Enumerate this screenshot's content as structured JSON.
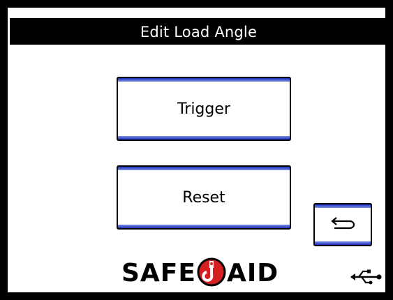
{
  "header": {
    "title": "Edit Load Angle"
  },
  "buttons": {
    "trigger_label": "Trigger",
    "reset_label": "Reset",
    "back_icon": "return-arrow-icon"
  },
  "footer": {
    "logo_left": "SAFE",
    "logo_right": "AID",
    "logo_mark": "hook-logo-icon",
    "usb_icon": "usb-icon"
  },
  "colors": {
    "title_bar": "#000000",
    "button_accent": "#1a2fb8",
    "logo_red": "#d42020"
  }
}
